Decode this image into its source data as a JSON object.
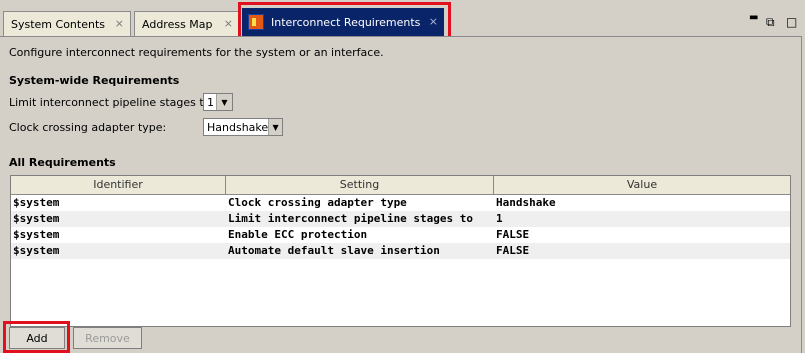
{
  "tabs": [
    {
      "label": "System Contents",
      "close_icon": "close-icon"
    },
    {
      "label": "Address Map",
      "close_icon": "close-icon"
    },
    {
      "label": "Interconnect Requirements",
      "icon": "interconnect-icon",
      "close_icon": "close-icon",
      "active": true
    }
  ],
  "window_controls": {
    "minimize": "▬",
    "restore": "⧉",
    "maximize": "□"
  },
  "description": "Configure interconnect requirements for the system or an interface.",
  "system_wide": {
    "heading": "System-wide Requirements",
    "pipeline_label": "Limit interconnect pipeline stages to:",
    "pipeline_value": "1",
    "clock_label": "Clock crossing adapter type:",
    "clock_value": "Handshake"
  },
  "all_requirements": {
    "heading": "All Requirements",
    "columns": [
      "Identifier",
      "Setting",
      "Value"
    ],
    "rows": [
      [
        "$system",
        "Clock crossing adapter type",
        "Handshake"
      ],
      [
        "$system",
        "Limit interconnect pipeline stages to",
        "1"
      ],
      [
        "$system",
        "Enable ECC protection",
        "FALSE"
      ],
      [
        "$system",
        "Automate default slave insertion",
        "FALSE"
      ]
    ]
  },
  "buttons": {
    "add": "Add",
    "remove": "Remove"
  },
  "colors": {
    "active_tab": "#0a246a",
    "highlight": "#e1101e",
    "panel": "#d4d0c8"
  }
}
